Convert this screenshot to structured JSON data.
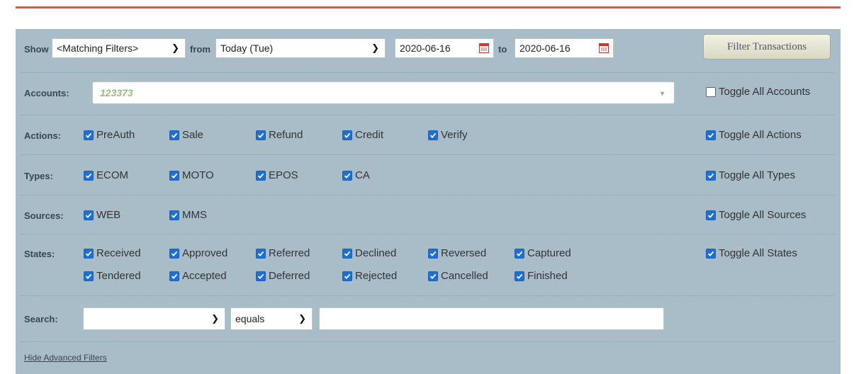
{
  "filterbar": {
    "show_label": "Show",
    "show_value": "<Matching Filters>",
    "from_label": "from",
    "period_value": "Today (Tue)",
    "date_from": "2020-06-16",
    "to_label": "to",
    "date_to": "2020-06-16",
    "filter_button": "Filter Transactions"
  },
  "accounts": {
    "label": "Accounts:",
    "value": "123373",
    "toggle": "Toggle All Accounts"
  },
  "actions": {
    "label": "Actions:",
    "items": [
      "PreAuth",
      "Sale",
      "Refund",
      "Credit",
      "Verify"
    ],
    "toggle": "Toggle All Actions"
  },
  "types": {
    "label": "Types:",
    "items": [
      "ECOM",
      "MOTO",
      "EPOS",
      "CA"
    ],
    "toggle": "Toggle All Types"
  },
  "sources": {
    "label": "Sources:",
    "items": [
      "WEB",
      "MMS"
    ],
    "toggle": "Toggle All Sources"
  },
  "states": {
    "label": "States:",
    "items": [
      "Received",
      "Approved",
      "Referred",
      "Declined",
      "Reversed",
      "Captured",
      "Tendered",
      "Accepted",
      "Deferred",
      "Rejected",
      "Cancelled",
      "Finished"
    ],
    "toggle": "Toggle All States"
  },
  "search": {
    "label": "Search:",
    "field_value": "",
    "operator_value": "equals",
    "text_value": ""
  },
  "footer": {
    "hide_link": "Hide Advanced Filters"
  },
  "colors": {
    "accent_rule": "#e8522e",
    "panel_bg": "#a9bdc8",
    "checkbox_blue": "#1f6fd1"
  }
}
